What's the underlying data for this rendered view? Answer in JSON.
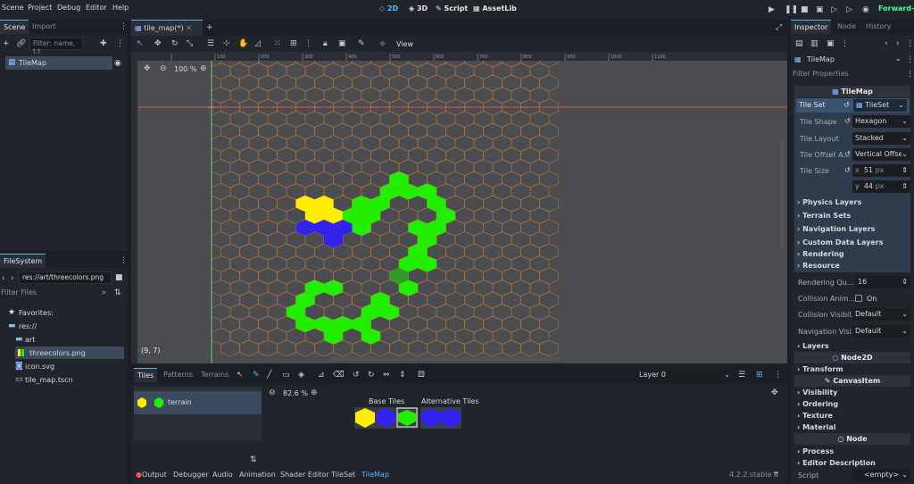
{
  "menu": [
    "Scene",
    "Project",
    "Debug",
    "Editor",
    "Help"
  ],
  "modes": {
    "m2d": "2D",
    "m3d": "3D",
    "script": "Script",
    "assetlib": "AssetLib"
  },
  "renderer": "Forward+",
  "scene_dock": {
    "tabs": [
      "Scene",
      "Import"
    ],
    "filter_placeholder": "Filter: name, t:t",
    "node": "TileMap"
  },
  "filesystem": {
    "tab": "FileSystem",
    "path": "res://art/threecolors.png",
    "filter_placeholder": "Filter Files",
    "favorites": "Favorites:",
    "items": [
      "res://",
      "art",
      "threecolors.png",
      "icon.svg",
      "tile_map.tscn"
    ]
  },
  "editor": {
    "tab": "tile_map(*)",
    "view_label": "View",
    "zoom": "100 %",
    "coords": "(9, 7)"
  },
  "tileset_panel": {
    "tabs": [
      "Tiles",
      "Patterns",
      "Terrains"
    ],
    "layer": "Layer 0",
    "terrain": "terrain",
    "zoom": "82.6 %",
    "base_tiles": "Base Tiles",
    "alt_tiles": "Alternative Tiles"
  },
  "bottom_tabs": [
    "Output",
    "Debugger",
    "Audio",
    "Animation",
    "Shader Editor",
    "TileSet",
    "TileMap"
  ],
  "version": "4.2.2.stable",
  "inspector": {
    "tabs": [
      "Inspector",
      "Node",
      "History"
    ],
    "object": "TileMap",
    "filter_placeholder": "Filter Properties",
    "class_header": "TileMap",
    "tile_set_label": "Tile Set",
    "tile_set_value": "TileSet",
    "props": [
      {
        "label": "Tile Shape",
        "value": "Hexagon"
      },
      {
        "label": "Tile Layout",
        "value": "Stacked"
      },
      {
        "label": "Tile Offset A...",
        "value": "Vertical Offse"
      }
    ],
    "tile_size_label": "Tile Size",
    "size_x": "51",
    "size_y": "44",
    "unit": "px",
    "x_label": "x",
    "y_label": "y",
    "sections": [
      "Physics Layers",
      "Terrain Sets",
      "Navigation Layers",
      "Custom Data Layers",
      "Rendering",
      "Resource"
    ],
    "rendering_q_label": "Rendering Qu...",
    "rendering_q_value": "16",
    "collision_anim_label": "Collision Anim...",
    "collision_anim_value": "On",
    "collision_vis_label": "Collision Visibil...",
    "collision_vis_value": "Default",
    "nav_vis_label": "Navigation Visi...",
    "nav_vis_value": "Default",
    "layers": "Layers",
    "node2d": "Node2D",
    "transform": "Transform",
    "canvasitem": "CanvasItem",
    "canvas_sections": [
      "Visibility",
      "Ordering",
      "Texture",
      "Material"
    ],
    "node": "Node",
    "node_sections": [
      "Process",
      "Editor Description"
    ],
    "script_label": "Script",
    "script_value": "<empty>"
  },
  "colors": {
    "accent": "#57b3ff",
    "green": "#22ee00",
    "yellow": "#ffee00",
    "blue": "#3322ee",
    "darkgreen": "#2f9a2a"
  },
  "ruler_ticks": [
    "",
    "100",
    "200",
    "300",
    "400",
    "500",
    "600",
    "700",
    "800",
    "900",
    "1000",
    "1100"
  ]
}
